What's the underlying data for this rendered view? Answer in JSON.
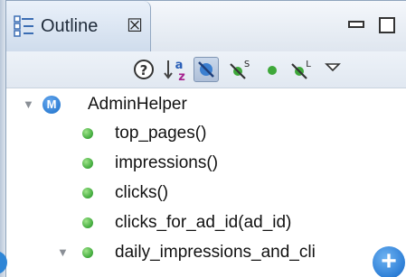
{
  "view": {
    "tab_title": "Outline",
    "close_glyph": "☒",
    "window_buttons": [
      "minimize-icon",
      "maximize-icon"
    ]
  },
  "toolbar": {
    "buttons": [
      {
        "icon": "help-icon",
        "active": false
      },
      {
        "icon": "sort-az-icon",
        "active": false
      },
      {
        "icon": "hide-fields-icon",
        "active": true
      },
      {
        "icon": "hide-static-icon",
        "active": false
      },
      {
        "icon": "public-members-icon",
        "active": false
      },
      {
        "icon": "hide-local-types-icon",
        "active": false
      },
      {
        "icon": "view-menu-icon",
        "active": false
      }
    ]
  },
  "tree": {
    "root": {
      "label": "AdminHelper",
      "badge": "M",
      "expanded": true
    },
    "methods": [
      "top_pages()",
      "impressions()",
      "clicks()",
      "clicks_for_ad_id(ad_id)",
      "daily_impressions_and_cli"
    ]
  },
  "colors": {
    "method_dot": "#3ea83a",
    "module_badge": "#2f7fd4",
    "sort_a": "#2a5fb8",
    "sort_z": "#a6228f"
  }
}
